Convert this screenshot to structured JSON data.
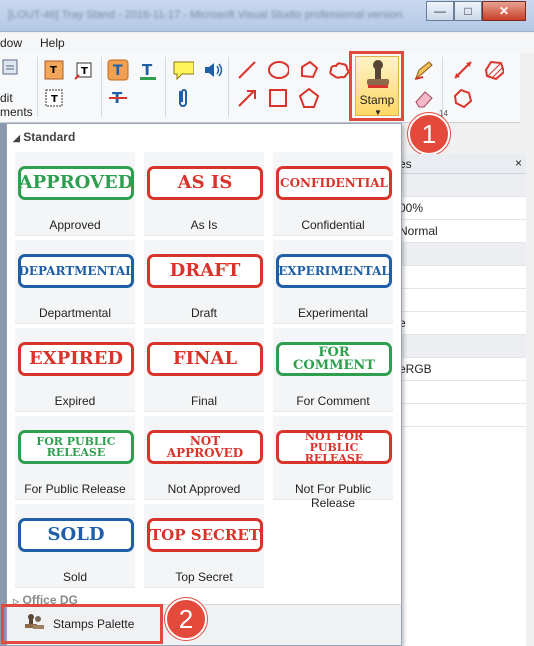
{
  "window": {
    "title": "[LOUT-46] Tray Stand - 2016-11-17 - Microsoft Visual Studio professional version"
  },
  "menu": {
    "items": [
      "dow",
      "Help"
    ]
  },
  "ribbon": {
    "left_label_1": "dit",
    "left_label_2": "ments",
    "stamp_label": "Stamp",
    "group_mark": "14"
  },
  "callouts": {
    "one": "1",
    "two": "2"
  },
  "colors": {
    "red": "#d9342b",
    "green": "#2e9e4f",
    "blue": "#1f5fa8",
    "highlight": "#e14a3c"
  },
  "dropdown": {
    "group_standard": "Standard",
    "group_office": "Office DG",
    "palette_button": "Stamps Palette",
    "stamps": [
      {
        "name": "Approved",
        "text": [
          "APPROVED"
        ],
        "color": "green"
      },
      {
        "name": "As Is",
        "text": [
          "AS IS"
        ],
        "color": "red"
      },
      {
        "name": "Confidential",
        "text": [
          "CONFIDENTIAL"
        ],
        "color": "red"
      },
      {
        "name": "Departmental",
        "text": [
          "DEPARTMENTAL"
        ],
        "color": "blue"
      },
      {
        "name": "Draft",
        "text": [
          "DRAFT"
        ],
        "color": "red"
      },
      {
        "name": "Experimental",
        "text": [
          "EXPERIMENTAL"
        ],
        "color": "blue"
      },
      {
        "name": "Expired",
        "text": [
          "EXPIRED"
        ],
        "color": "red"
      },
      {
        "name": "Final",
        "text": [
          "FINAL"
        ],
        "color": "red"
      },
      {
        "name": "For Comment",
        "text": [
          "FOR COMMENT"
        ],
        "color": "green"
      },
      {
        "name": "For Public Release",
        "text": [
          "FOR PUBLIC",
          "RELEASE"
        ],
        "color": "green"
      },
      {
        "name": "Not Approved",
        "text": [
          "NOT APPROVED"
        ],
        "color": "red"
      },
      {
        "name": "Not For Public Release",
        "text": [
          "NOT FOR",
          "PUBLIC RELEASE"
        ],
        "color": "red"
      },
      {
        "name": "Sold",
        "text": [
          "SOLD"
        ],
        "color": "blue"
      },
      {
        "name": "Top Secret",
        "text": [
          "TOP SECRET"
        ],
        "color": "red"
      }
    ]
  },
  "properties_panel": {
    "header": "es",
    "close": "×",
    "rows": [
      "00%",
      "Normal",
      "",
      "",
      "",
      "e",
      "",
      "eRGB",
      "",
      ""
    ]
  }
}
